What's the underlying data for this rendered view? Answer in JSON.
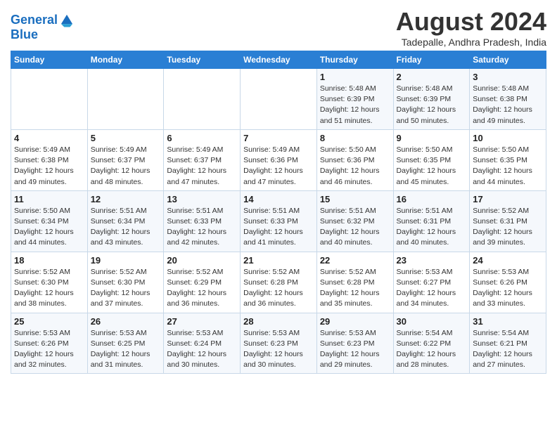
{
  "logo": {
    "line1": "General",
    "line2": "Blue"
  },
  "title": "August 2024",
  "subtitle": "Tadepalle, Andhra Pradesh, India",
  "headers": [
    "Sunday",
    "Monday",
    "Tuesday",
    "Wednesday",
    "Thursday",
    "Friday",
    "Saturday"
  ],
  "weeks": [
    [
      {
        "day": "",
        "info": ""
      },
      {
        "day": "",
        "info": ""
      },
      {
        "day": "",
        "info": ""
      },
      {
        "day": "",
        "info": ""
      },
      {
        "day": "1",
        "info": "Sunrise: 5:48 AM\nSunset: 6:39 PM\nDaylight: 12 hours\nand 51 minutes."
      },
      {
        "day": "2",
        "info": "Sunrise: 5:48 AM\nSunset: 6:39 PM\nDaylight: 12 hours\nand 50 minutes."
      },
      {
        "day": "3",
        "info": "Sunrise: 5:48 AM\nSunset: 6:38 PM\nDaylight: 12 hours\nand 49 minutes."
      }
    ],
    [
      {
        "day": "4",
        "info": "Sunrise: 5:49 AM\nSunset: 6:38 PM\nDaylight: 12 hours\nand 49 minutes."
      },
      {
        "day": "5",
        "info": "Sunrise: 5:49 AM\nSunset: 6:37 PM\nDaylight: 12 hours\nand 48 minutes."
      },
      {
        "day": "6",
        "info": "Sunrise: 5:49 AM\nSunset: 6:37 PM\nDaylight: 12 hours\nand 47 minutes."
      },
      {
        "day": "7",
        "info": "Sunrise: 5:49 AM\nSunset: 6:36 PM\nDaylight: 12 hours\nand 47 minutes."
      },
      {
        "day": "8",
        "info": "Sunrise: 5:50 AM\nSunset: 6:36 PM\nDaylight: 12 hours\nand 46 minutes."
      },
      {
        "day": "9",
        "info": "Sunrise: 5:50 AM\nSunset: 6:35 PM\nDaylight: 12 hours\nand 45 minutes."
      },
      {
        "day": "10",
        "info": "Sunrise: 5:50 AM\nSunset: 6:35 PM\nDaylight: 12 hours\nand 44 minutes."
      }
    ],
    [
      {
        "day": "11",
        "info": "Sunrise: 5:50 AM\nSunset: 6:34 PM\nDaylight: 12 hours\nand 44 minutes."
      },
      {
        "day": "12",
        "info": "Sunrise: 5:51 AM\nSunset: 6:34 PM\nDaylight: 12 hours\nand 43 minutes."
      },
      {
        "day": "13",
        "info": "Sunrise: 5:51 AM\nSunset: 6:33 PM\nDaylight: 12 hours\nand 42 minutes."
      },
      {
        "day": "14",
        "info": "Sunrise: 5:51 AM\nSunset: 6:33 PM\nDaylight: 12 hours\nand 41 minutes."
      },
      {
        "day": "15",
        "info": "Sunrise: 5:51 AM\nSunset: 6:32 PM\nDaylight: 12 hours\nand 40 minutes."
      },
      {
        "day": "16",
        "info": "Sunrise: 5:51 AM\nSunset: 6:31 PM\nDaylight: 12 hours\nand 40 minutes."
      },
      {
        "day": "17",
        "info": "Sunrise: 5:52 AM\nSunset: 6:31 PM\nDaylight: 12 hours\nand 39 minutes."
      }
    ],
    [
      {
        "day": "18",
        "info": "Sunrise: 5:52 AM\nSunset: 6:30 PM\nDaylight: 12 hours\nand 38 minutes."
      },
      {
        "day": "19",
        "info": "Sunrise: 5:52 AM\nSunset: 6:30 PM\nDaylight: 12 hours\nand 37 minutes."
      },
      {
        "day": "20",
        "info": "Sunrise: 5:52 AM\nSunset: 6:29 PM\nDaylight: 12 hours\nand 36 minutes."
      },
      {
        "day": "21",
        "info": "Sunrise: 5:52 AM\nSunset: 6:28 PM\nDaylight: 12 hours\nand 36 minutes."
      },
      {
        "day": "22",
        "info": "Sunrise: 5:52 AM\nSunset: 6:28 PM\nDaylight: 12 hours\nand 35 minutes."
      },
      {
        "day": "23",
        "info": "Sunrise: 5:53 AM\nSunset: 6:27 PM\nDaylight: 12 hours\nand 34 minutes."
      },
      {
        "day": "24",
        "info": "Sunrise: 5:53 AM\nSunset: 6:26 PM\nDaylight: 12 hours\nand 33 minutes."
      }
    ],
    [
      {
        "day": "25",
        "info": "Sunrise: 5:53 AM\nSunset: 6:26 PM\nDaylight: 12 hours\nand 32 minutes."
      },
      {
        "day": "26",
        "info": "Sunrise: 5:53 AM\nSunset: 6:25 PM\nDaylight: 12 hours\nand 31 minutes."
      },
      {
        "day": "27",
        "info": "Sunrise: 5:53 AM\nSunset: 6:24 PM\nDaylight: 12 hours\nand 30 minutes."
      },
      {
        "day": "28",
        "info": "Sunrise: 5:53 AM\nSunset: 6:23 PM\nDaylight: 12 hours\nand 30 minutes."
      },
      {
        "day": "29",
        "info": "Sunrise: 5:53 AM\nSunset: 6:23 PM\nDaylight: 12 hours\nand 29 minutes."
      },
      {
        "day": "30",
        "info": "Sunrise: 5:54 AM\nSunset: 6:22 PM\nDaylight: 12 hours\nand 28 minutes."
      },
      {
        "day": "31",
        "info": "Sunrise: 5:54 AM\nSunset: 6:21 PM\nDaylight: 12 hours\nand 27 minutes."
      }
    ]
  ]
}
